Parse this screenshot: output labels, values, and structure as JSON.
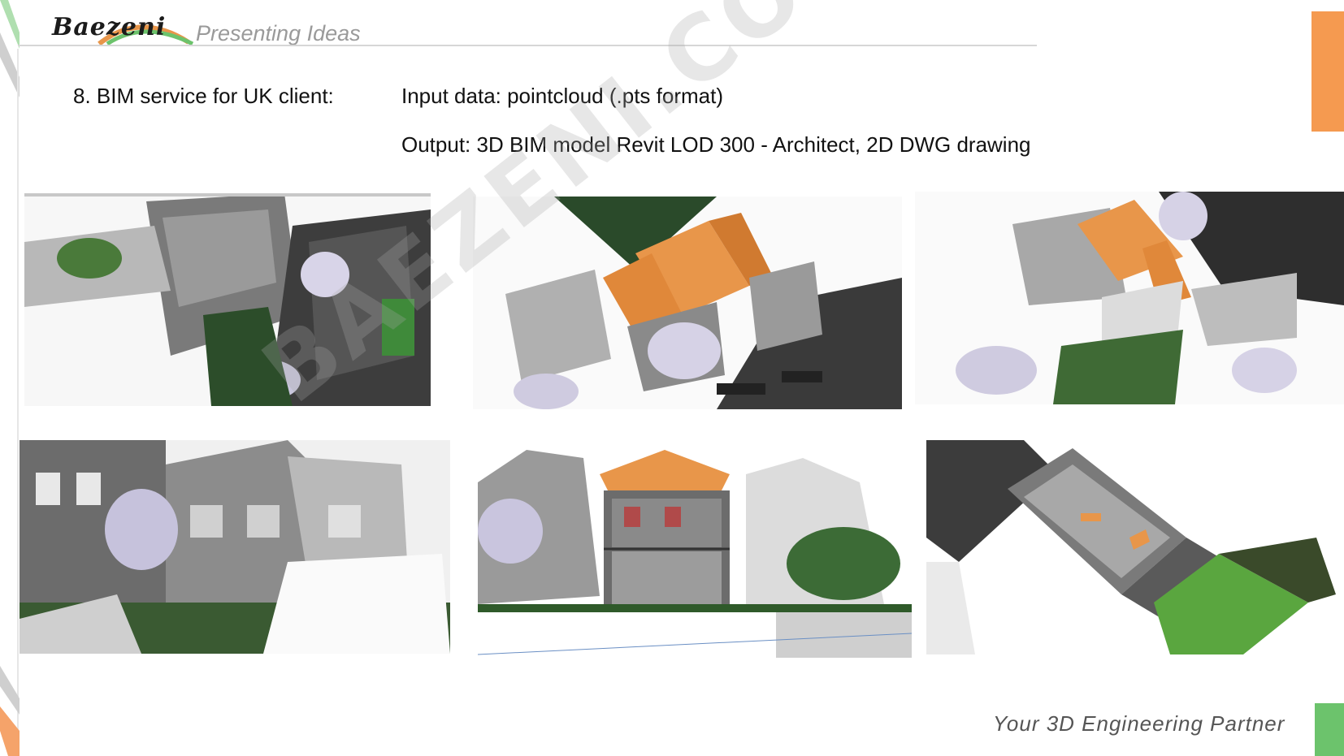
{
  "header": {
    "logo_text": "Baezeni",
    "tagline": "Presenting Ideas"
  },
  "content": {
    "section_title": "8. BIM service for UK client:",
    "input_line": "Input data: pointcloud (.pts format)",
    "output_line": "Output: 3D BIM model Revit LOD 300 - Architect, 2D DWG drawing"
  },
  "footer": {
    "tagline": "Your 3D Engineering Partner"
  },
  "watermark": "BAEZENI.COM",
  "colors": {
    "accent_orange": "#f59a50",
    "accent_green": "#6cc36c",
    "roof_orange": "#e8964a",
    "rule_gray": "#d6d6d6"
  },
  "images": [
    {
      "name": "pointcloud-aerial-view"
    },
    {
      "name": "bim-roof-overlay-view-1"
    },
    {
      "name": "bim-roof-overlay-view-2"
    },
    {
      "name": "pointcloud-street-facade"
    },
    {
      "name": "bim-section-elevation"
    },
    {
      "name": "bim-floorplan-3d-cut"
    }
  ]
}
